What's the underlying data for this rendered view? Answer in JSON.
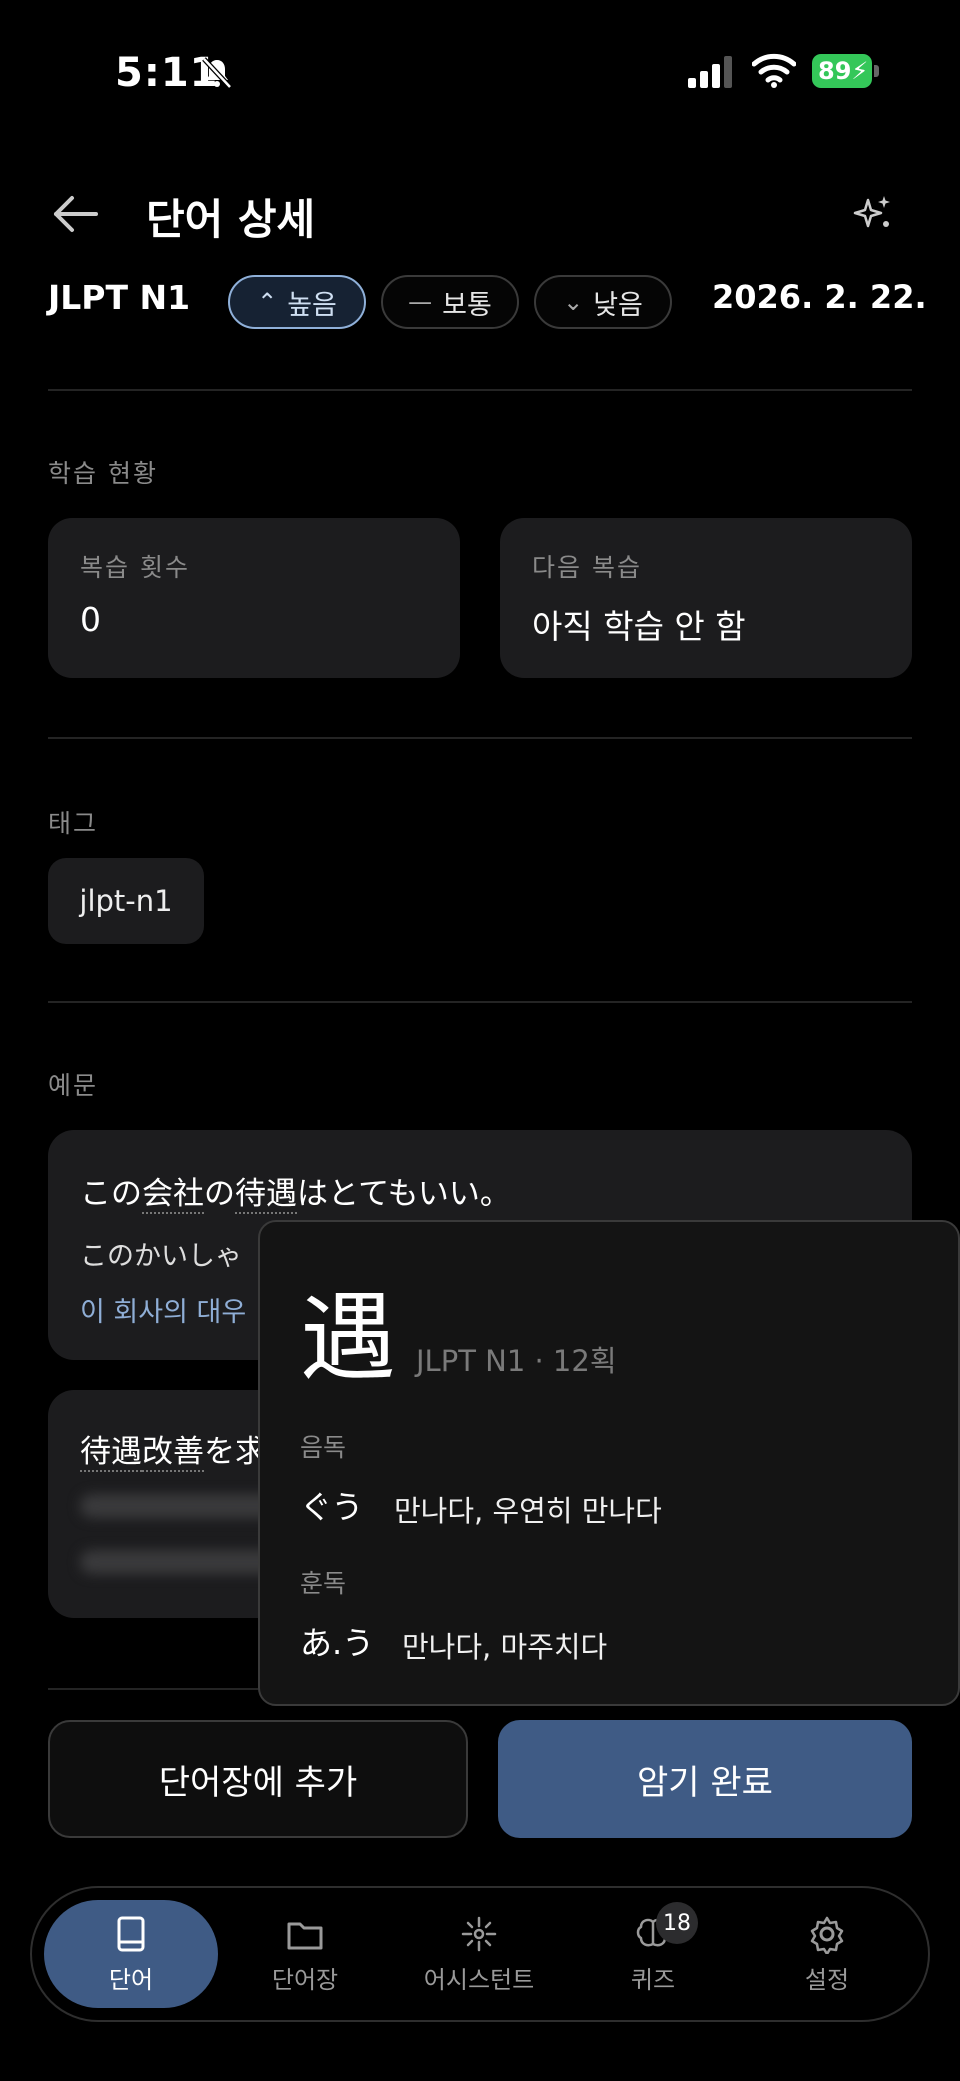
{
  "status_bar": {
    "time": "5:11",
    "battery": "89"
  },
  "header": {
    "title": "단어 상세"
  },
  "word_meta": {
    "level": "JLPT N1",
    "priority": [
      {
        "label": "높음",
        "glyph": "⌃",
        "active": true
      },
      {
        "label": "보통",
        "glyph": "—",
        "active": false
      },
      {
        "label": "낮음",
        "glyph": "⌄",
        "active": false
      }
    ],
    "date": "2026. 2. 22."
  },
  "study_status": {
    "section_label": "학습 현황",
    "review_count_label": "복습 횟수",
    "review_count_value": "0",
    "next_review_label": "다음 복습",
    "next_review_value": "아직 학습 안 함"
  },
  "tags": {
    "section_label": "태그",
    "items": [
      "jlpt-n1"
    ]
  },
  "examples": {
    "section_label": "예문",
    "items": [
      {
        "jp_parts": [
          "この",
          "会社",
          "の",
          "待遇",
          "はとてもいい。"
        ],
        "reading": "このかいしゃ",
        "translation": "이 회사의 대우"
      },
      {
        "jp_parts": [
          "待遇",
          "改善",
          "を求"
        ]
      }
    ]
  },
  "kanji_popup": {
    "kanji": "遇",
    "meta": "JLPT N1 · 12획",
    "on_label": "음독",
    "on_reading": "ぐう",
    "on_meaning": "만나다, 우연히 만나다",
    "kun_label": "훈독",
    "kun_reading": "あ.う",
    "kun_meaning": "만나다, 마주치다"
  },
  "actions": {
    "add_label": "단어장에 추가",
    "done_label": "암기 완료"
  },
  "nav": {
    "items": [
      {
        "label": "단어",
        "icon": "book-icon",
        "active": true
      },
      {
        "label": "단어장",
        "icon": "folder-icon",
        "active": false
      },
      {
        "label": "어시스턴트",
        "icon": "sparkle-icon",
        "active": false
      },
      {
        "label": "퀴즈",
        "icon": "brain-icon",
        "active": false,
        "badge": "18"
      },
      {
        "label": "설정",
        "icon": "gear-icon",
        "active": false
      }
    ]
  },
  "colors": {
    "accent": "#3f5b85",
    "chip_active": "#8fb0d9",
    "translation": "#8faed6",
    "battery": "#34c759"
  }
}
